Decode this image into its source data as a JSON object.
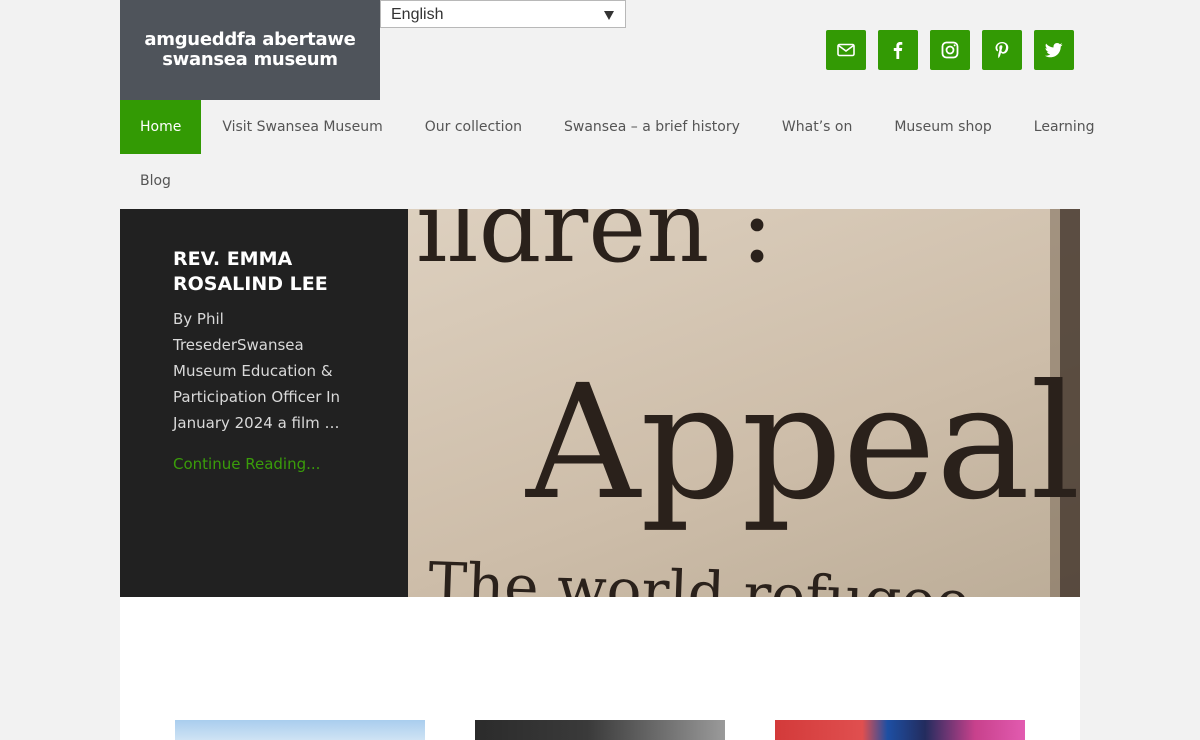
{
  "logo": {
    "line1": "amgueddfa abertawe",
    "line2": "swansea museum"
  },
  "language": {
    "selected": "English"
  },
  "social": [
    {
      "name": "email",
      "icon": "envelope-icon"
    },
    {
      "name": "facebook",
      "icon": "facebook-icon"
    },
    {
      "name": "instagram",
      "icon": "instagram-icon"
    },
    {
      "name": "pinterest",
      "icon": "pinterest-icon"
    },
    {
      "name": "twitter",
      "icon": "twitter-icon"
    }
  ],
  "nav": {
    "items": [
      {
        "label": "Home"
      },
      {
        "label": "Visit Swansea Museum"
      },
      {
        "label": "Our collection"
      },
      {
        "label": "Swansea – a brief history"
      },
      {
        "label": "What’s on"
      },
      {
        "label": "Museum shop"
      },
      {
        "label": "Learning"
      },
      {
        "label": "Blog"
      }
    ]
  },
  "hero": {
    "title": "REV. EMMA ROSALIND LEE",
    "excerpt": "By Phil TresederSwansea Museum Education & Participation Officer In January 2024 a film …",
    "more_label": "Continue Reading...",
    "image_text": {
      "top": "ildren :",
      "middle": "Appeal",
      "bottom": "The world refugee"
    }
  },
  "colors": {
    "accent": "#339a04",
    "logo_bg": "#4f545b",
    "hero_bg": "#212121",
    "page_bg": "#f2f2f2"
  }
}
